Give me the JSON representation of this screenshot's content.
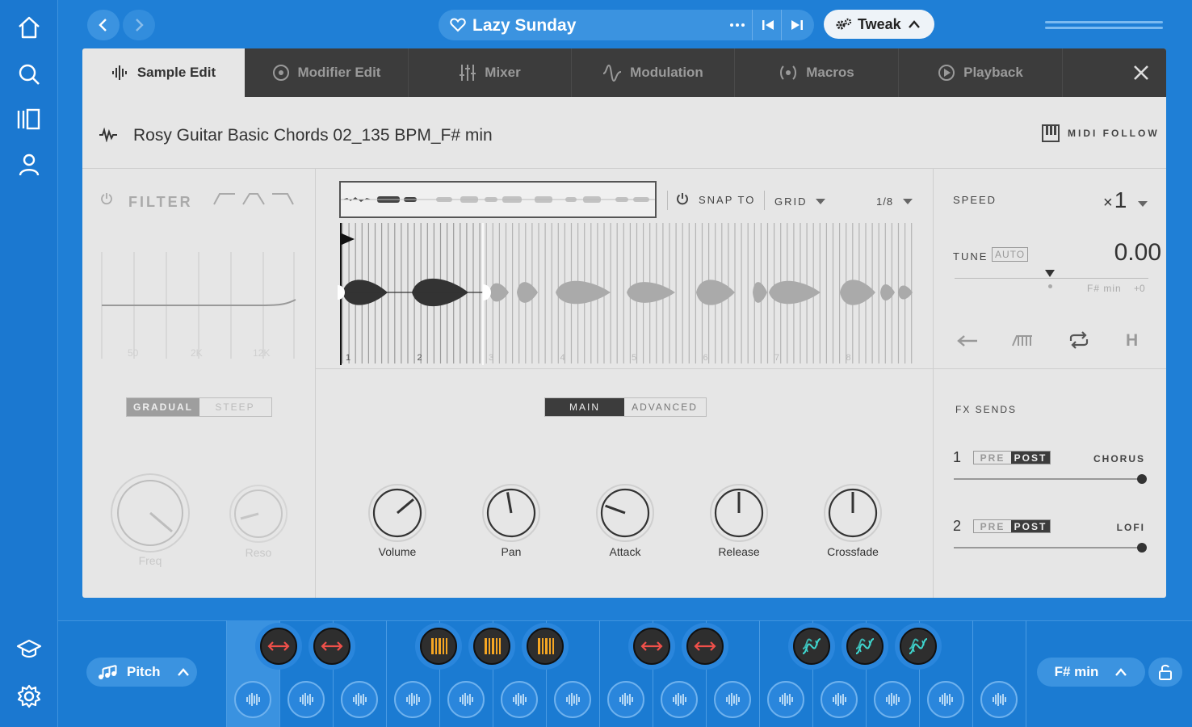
{
  "nav": {
    "icons": [
      "home-icon",
      "search-icon",
      "library-icon",
      "user-icon",
      "learn-icon",
      "settings-icon"
    ]
  },
  "header": {
    "project_title": "Lazy Sunday",
    "tweak_label": "Tweak"
  },
  "tabs": [
    {
      "label": "Sample Edit",
      "active": true
    },
    {
      "label": "Modifier Edit"
    },
    {
      "label": "Mixer"
    },
    {
      "label": "Modulation"
    },
    {
      "label": "Macros"
    },
    {
      "label": "Playback"
    }
  ],
  "sample": {
    "name": "Rosy Guitar Basic Chords 02_135 BPM_F# min",
    "midi_follow": "MIDI FOLLOW"
  },
  "filter": {
    "label": "FILTER",
    "freq_ticks": [
      "50",
      "2K",
      "12K"
    ],
    "slope_options": [
      "GRADUAL",
      "STEEP"
    ],
    "slope_selected": "GRADUAL",
    "knobs": [
      "Freq",
      "Reso"
    ]
  },
  "editor": {
    "snap_label": "SNAP TO",
    "snap_mode": "GRID",
    "grid_value": "1/8",
    "bar_numbers": [
      "1",
      "2",
      "3",
      "4",
      "5",
      "6",
      "7",
      "8"
    ],
    "view_options": [
      "MAIN",
      "ADVANCED"
    ],
    "view_selected": "MAIN",
    "knobs": [
      "Volume",
      "Pan",
      "Attack",
      "Release",
      "Crossfade"
    ]
  },
  "playback": {
    "speed_label": "SPEED",
    "speed_prefix": "×",
    "speed_value": "1",
    "tune_label": "TUNE",
    "auto_label": "AUTO",
    "tune_value": "0.00",
    "key_label": "F# min",
    "key_offset": "+0",
    "fx_sends_label": "FX SENDS",
    "sends": [
      {
        "num": "1",
        "pre": "PRE",
        "post": "POST",
        "name": "CHORUS"
      },
      {
        "num": "2",
        "pre": "PRE",
        "post": "POST",
        "name": "LOFI"
      }
    ]
  },
  "bottom": {
    "mode_label": "Pitch",
    "key_label": "F# min"
  },
  "colors": {
    "accent": "#1f7fd6",
    "panel": "#e6e6e6",
    "tabbar": "#3c3c3c",
    "pad_red": "#f0504a",
    "pad_orange": "#f5a623",
    "pad_teal": "#3fd6cf"
  }
}
